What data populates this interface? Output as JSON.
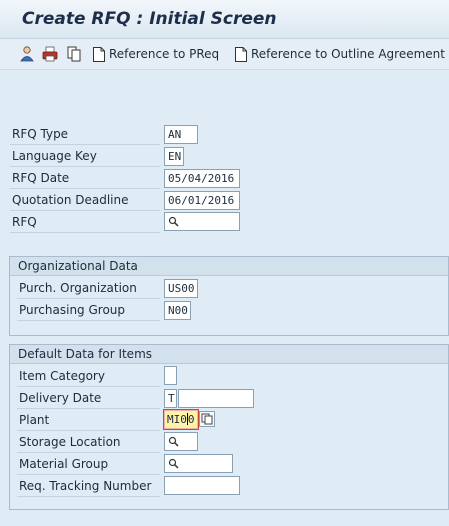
{
  "title": "Create RFQ : Initial Screen",
  "toolbar": {
    "items": [
      {
        "icon": "person-icon"
      },
      {
        "icon": "print-icon"
      },
      {
        "icon": "copy-icon"
      },
      {
        "icon": "document-icon",
        "label": "Reference to PReq"
      },
      {
        "icon": "document-icon",
        "label": "Reference to Outline Agreement"
      }
    ]
  },
  "header_fields": {
    "rfq_type": {
      "label": "RFQ Type",
      "value": "AN"
    },
    "language_key": {
      "label": "Language Key",
      "value": "EN"
    },
    "rfq_date": {
      "label": "RFQ Date",
      "value": "05/04/2016"
    },
    "quotation_deadline": {
      "label": "Quotation Deadline",
      "value": "06/01/2016"
    },
    "rfq": {
      "label": "RFQ",
      "value": ""
    }
  },
  "org_data": {
    "title": "Organizational Data",
    "purch_org": {
      "label": "Purch. Organization",
      "value": "US00"
    },
    "purch_group": {
      "label": "Purchasing Group",
      "value": "N00"
    }
  },
  "default_data": {
    "title": "Default Data for Items",
    "item_category": {
      "label": "Item Category",
      "value": ""
    },
    "delivery_date": {
      "label": "Delivery Date",
      "type_value": "T",
      "value": ""
    },
    "plant": {
      "label": "Plant",
      "value_before_cursor": "MI0",
      "value_after_cursor": "0"
    },
    "storage_location": {
      "label": "Storage Location",
      "value": ""
    },
    "material_group": {
      "label": "Material Group",
      "value": ""
    },
    "req_tracking": {
      "label": "Req. Tracking Number",
      "value": ""
    }
  }
}
